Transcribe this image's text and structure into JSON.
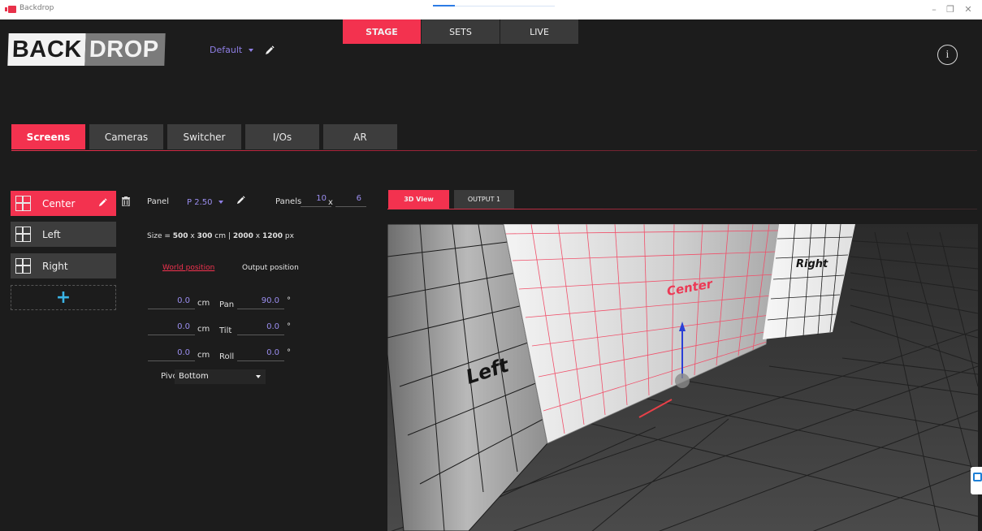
{
  "window": {
    "title": "Backdrop",
    "min": "–",
    "restore": "❐",
    "close": "✕",
    "progress_fraction": 0.18
  },
  "logo": {
    "part1": "BACK",
    "part2": "DROP"
  },
  "profile": {
    "name": "Default"
  },
  "modes": [
    {
      "label": "STAGE",
      "active": true
    },
    {
      "label": "SETS",
      "active": false
    },
    {
      "label": "LIVE",
      "active": false
    }
  ],
  "info_icon": "i",
  "sections": [
    "Screens",
    "Cameras",
    "Switcher",
    "I/Os",
    "AR"
  ],
  "screens": [
    {
      "name": "Center"
    },
    {
      "name": "Left"
    },
    {
      "name": "Right"
    }
  ],
  "add_label": "+",
  "panel": {
    "label": "Panel",
    "value": "P 2.50",
    "count_label": "Panels",
    "count_x": "10",
    "x_sep": "x",
    "count_y": "6"
  },
  "size": {
    "prefix": "Size = ",
    "cm_w": "500",
    "times": "x",
    "cm_h": "300",
    "cm_unit": "cm",
    "sep": "|",
    "px_w": "2000",
    "px_h": "1200",
    "px_unit": "px"
  },
  "position_tabs": {
    "world": "World position",
    "output": "Output position"
  },
  "coords": [
    {
      "value": "0.0",
      "unit": "cm",
      "rot_label": "Pan",
      "rot_value": "90.0",
      "rot_unit": "°"
    },
    {
      "value": "0.0",
      "unit": "cm",
      "rot_label": "Tilt",
      "rot_value": "0.0",
      "rot_unit": "°"
    },
    {
      "value": "0.0",
      "unit": "cm",
      "rot_label": "Roll",
      "rot_value": "0.0",
      "rot_unit": "°"
    }
  ],
  "pivot": {
    "label": "Pivot",
    "value": "Bottom"
  },
  "view_tabs": [
    {
      "label": "3D View",
      "active": true
    },
    {
      "label": "OUTPUT 1",
      "active": false
    }
  ],
  "scene_labels": {
    "left": "Left",
    "center": "Center",
    "right": "Right"
  },
  "colors": {
    "accent": "#f3324f",
    "value_purple": "#9b8ef0",
    "add_blue": "#3ab4e6"
  },
  "icons": [
    "pencil-icon",
    "trash-icon",
    "grid-icon",
    "info-icon",
    "caret-down-icon",
    "plus-icon"
  ]
}
